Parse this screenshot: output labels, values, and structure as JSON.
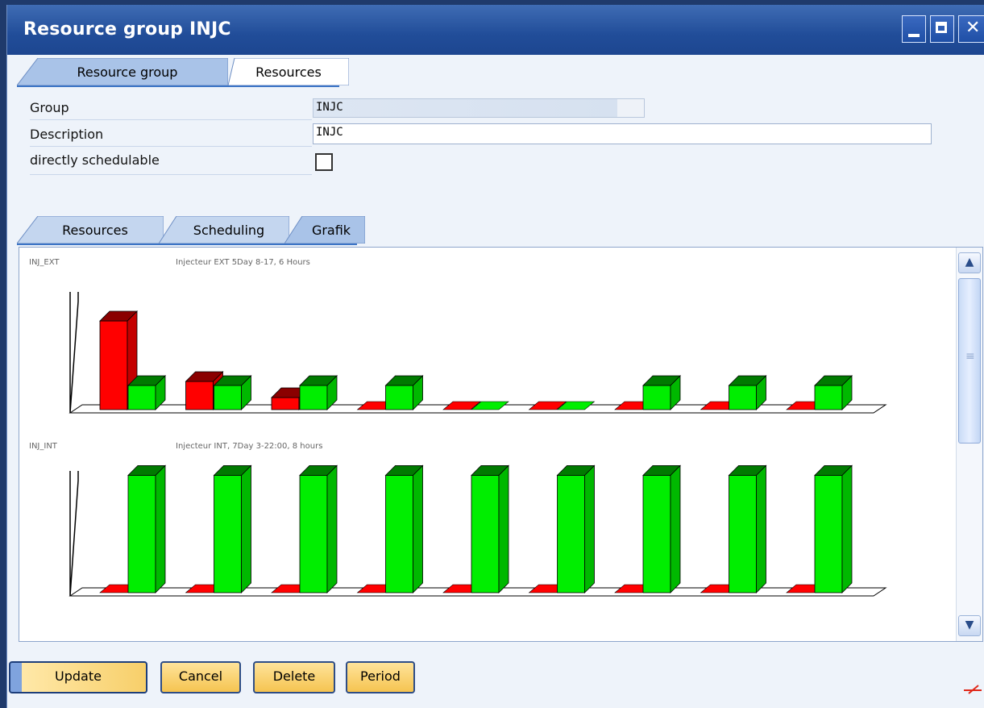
{
  "window": {
    "title": "Resource group INJC"
  },
  "top_tabs": [
    {
      "label": "Resource group",
      "active": true
    },
    {
      "label": "Resources",
      "active": false
    }
  ],
  "form": {
    "group_label": "Group",
    "group_value": "INJC",
    "description_label": "Description",
    "description_value": "INJC",
    "schedulable_label": "directly schedulable",
    "schedulable_checked": false
  },
  "bottom_tabs": [
    {
      "label": "Resources",
      "active": false
    },
    {
      "label": "Scheduling",
      "active": false
    },
    {
      "label": "Grafik",
      "active": true
    }
  ],
  "colors": {
    "used": "#ff0000",
    "available": "#00ee00",
    "titlebar": "#214d99",
    "tab_active": "#a9c3e8"
  },
  "chart_data": [
    {
      "type": "bar",
      "resource": "INJ_EXT",
      "title": "Injecteur EXT 5Day 8-17, 6 Hours",
      "series": [
        {
          "color": "red",
          "values": [
            22,
            7,
            3,
            0,
            0,
            0,
            0,
            0,
            0
          ]
        },
        {
          "color": "green",
          "values": [
            6,
            6,
            6,
            6,
            0,
            0,
            6,
            6,
            6
          ]
        }
      ]
    },
    {
      "type": "bar",
      "resource": "INJ_INT",
      "title": "Injecteur INT, 7Day 3-22:00, 8 hours",
      "series": [
        {
          "color": "red",
          "values": [
            0,
            0,
            0,
            0,
            0,
            0,
            0,
            0,
            0
          ]
        },
        {
          "color": "green",
          "values": [
            8,
            8,
            8,
            8,
            8,
            8,
            8,
            8,
            8
          ]
        }
      ]
    }
  ],
  "buttons": {
    "update": "Update",
    "cancel": "Cancel",
    "delete": "Delete",
    "period": "Period"
  }
}
